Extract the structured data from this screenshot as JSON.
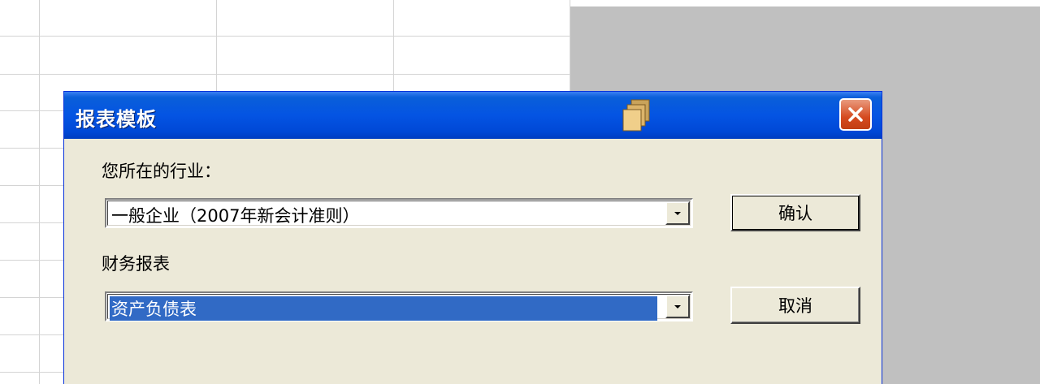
{
  "dialog": {
    "title": "报表模板",
    "industry_label": "您所在的行业：",
    "industry_value": "一般企业（2007年新会计准则）",
    "report_label": "财务报表",
    "report_value": "资产负债表",
    "confirm_label": "确认",
    "cancel_label": "取消",
    "title_icon": "copy-pages-icon",
    "close_icon": "close-icon"
  },
  "colors": {
    "titlebar": "#0454e3",
    "dialog_bg": "#ece9d8",
    "selection": "#316ac5",
    "close": "#d54a1f"
  }
}
